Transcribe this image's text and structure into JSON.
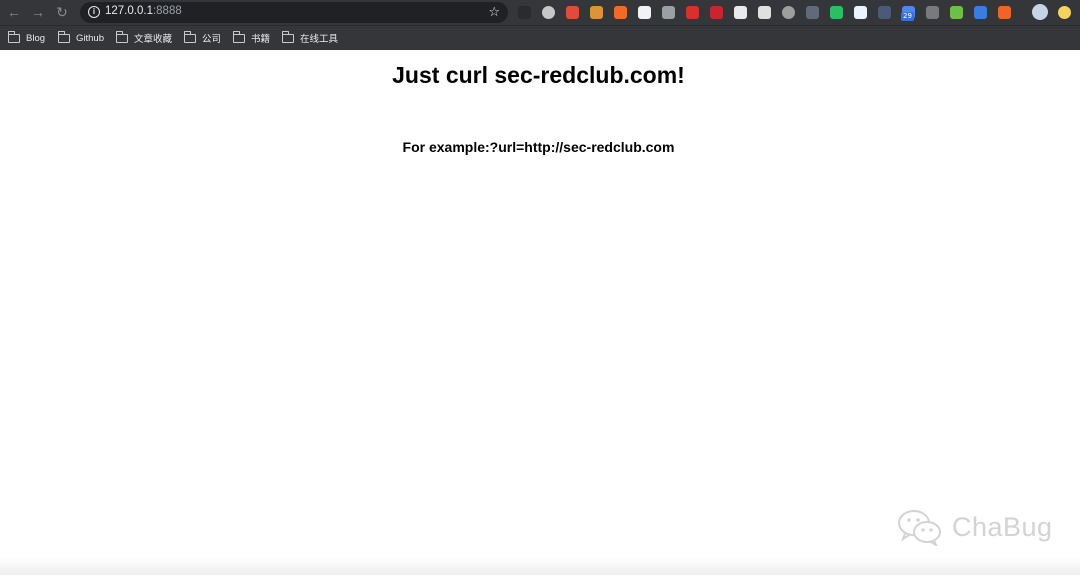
{
  "browser": {
    "back_glyph": "←",
    "forward_glyph": "→",
    "reload_glyph": "↻",
    "url_host": "127.0.0.1",
    "url_port": ":8888",
    "bookmark_glyph": "☆",
    "extension_icons": [
      {
        "name": "power-ext-icon",
        "color": "#2a2b2e"
      },
      {
        "name": "record-ext-icon",
        "color": "#c7c7c7"
      },
      {
        "name": "red-square-ext-icon",
        "color": "#e04b3a"
      },
      {
        "name": "cookie-ext-icon",
        "color": "#d9953b"
      },
      {
        "name": "orange-x-ext-icon",
        "color": "#f06b2a"
      },
      {
        "name": "page-ext-icon",
        "color": "#f2f2f2"
      },
      {
        "name": "glasses-ext-icon",
        "color": "#9aa0a6"
      },
      {
        "name": "red-pin-ext-icon",
        "color": "#d9302c"
      },
      {
        "name": "red-bug-ext-icon",
        "color": "#c9252c"
      },
      {
        "name": "mask-ext-icon",
        "color": "#e8eaed"
      },
      {
        "name": "chat-ext-icon",
        "color": "#e0e0e0"
      },
      {
        "name": "gear-globe-ext-icon",
        "color": "#9e9e9e"
      },
      {
        "name": "dots-ext-icon",
        "color": "#5f6a7a"
      },
      {
        "name": "evernote-ext-icon",
        "color": "#2dbe60"
      },
      {
        "name": "diamond-ext-icon",
        "color": "#e8f4ff"
      },
      {
        "name": "text-ext-icon",
        "color": "#4a5a78"
      },
      {
        "name": "calendar-badge-ext-icon",
        "color": "#4f87e8"
      },
      {
        "name": "settings-ext-icon",
        "color": "#7a7a7a"
      },
      {
        "name": "green-leaf-ext-icon",
        "color": "#6dbf4b"
      },
      {
        "name": "blue-wing-ext-icon",
        "color": "#3b7ddd"
      },
      {
        "name": "orange-app-ext-icon",
        "color": "#f0642c"
      },
      {
        "name": "profile-avatar-icon",
        "color": "#c7d3e6"
      },
      {
        "name": "yellow-circle-ext-icon",
        "color": "#f4d35e"
      }
    ],
    "calendar_badge": "29",
    "bookmarks": [
      "Blog",
      "Github",
      "文章收藏",
      "公司",
      "书籍",
      "在线工具"
    ]
  },
  "page": {
    "headline": "Just curl sec-redclub.com!",
    "example_text": "For example:?url=http://sec-redclub.com"
  },
  "watermark": {
    "text": "ChaBug"
  }
}
